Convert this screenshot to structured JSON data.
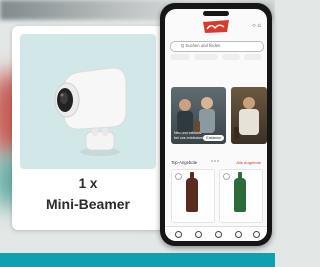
{
  "card": {
    "quantity": "1 x",
    "product_name": "Mini-Beamer"
  },
  "app": {
    "search_placeholder": "Q Suchen und finden",
    "promo_left_text": "Neu und exklusiv bei uns entdecken",
    "promo_button": "Entdecke",
    "section_title": "Top-Angebote",
    "section_link": "Alle Angebote"
  },
  "colors": {
    "accent": "#10a0b2",
    "card_image_bg": "#d2e7e8",
    "logo_red": "#d83a2e"
  }
}
